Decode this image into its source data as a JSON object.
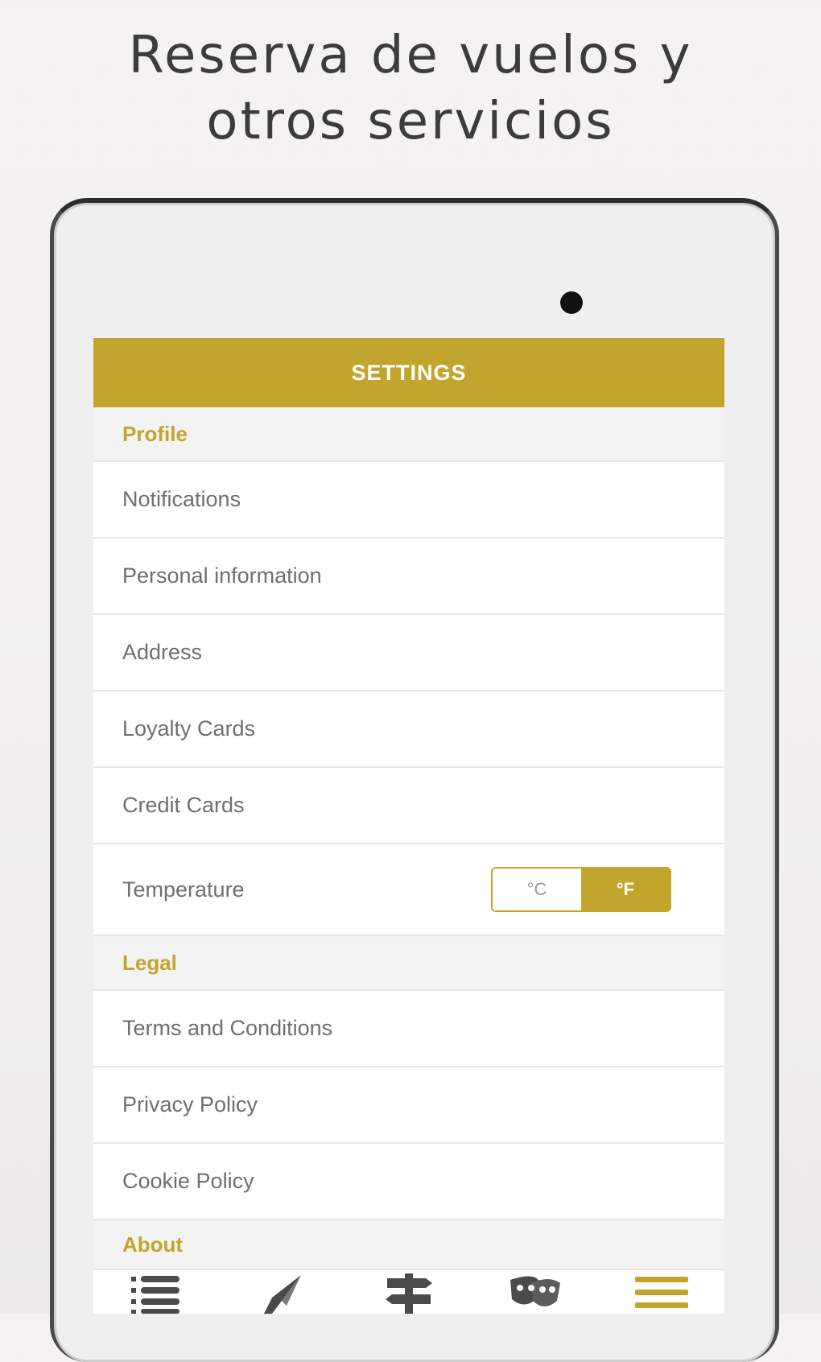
{
  "headline": {
    "line1": "Reserva de vuelos y",
    "line2": "otros servicios"
  },
  "app_bar": {
    "title": "SETTINGS"
  },
  "sections": {
    "profile": {
      "title": "Profile",
      "items": [
        "Notifications",
        "Personal information",
        "Address",
        "Loyalty Cards",
        "Credit Cards"
      ],
      "temperature": {
        "label": "Temperature",
        "options": [
          "°C",
          "°F"
        ],
        "selected": "°F"
      }
    },
    "legal": {
      "title": "Legal",
      "items": [
        "Terms and Conditions",
        "Privacy Policy",
        "Cookie Policy"
      ]
    },
    "about": {
      "title": "About"
    }
  },
  "bottom_nav": {
    "items": [
      {
        "icon": "list-icon"
      },
      {
        "icon": "compass-icon"
      },
      {
        "icon": "signpost-icon"
      },
      {
        "icon": "theater-masks-icon"
      },
      {
        "icon": "menu-icon",
        "active": true
      }
    ]
  },
  "colors": {
    "accent": "#c2a52d",
    "text": "#6f6f6f",
    "section_bg": "#f3f3f3",
    "nav_icon": "#4a4a4a"
  }
}
